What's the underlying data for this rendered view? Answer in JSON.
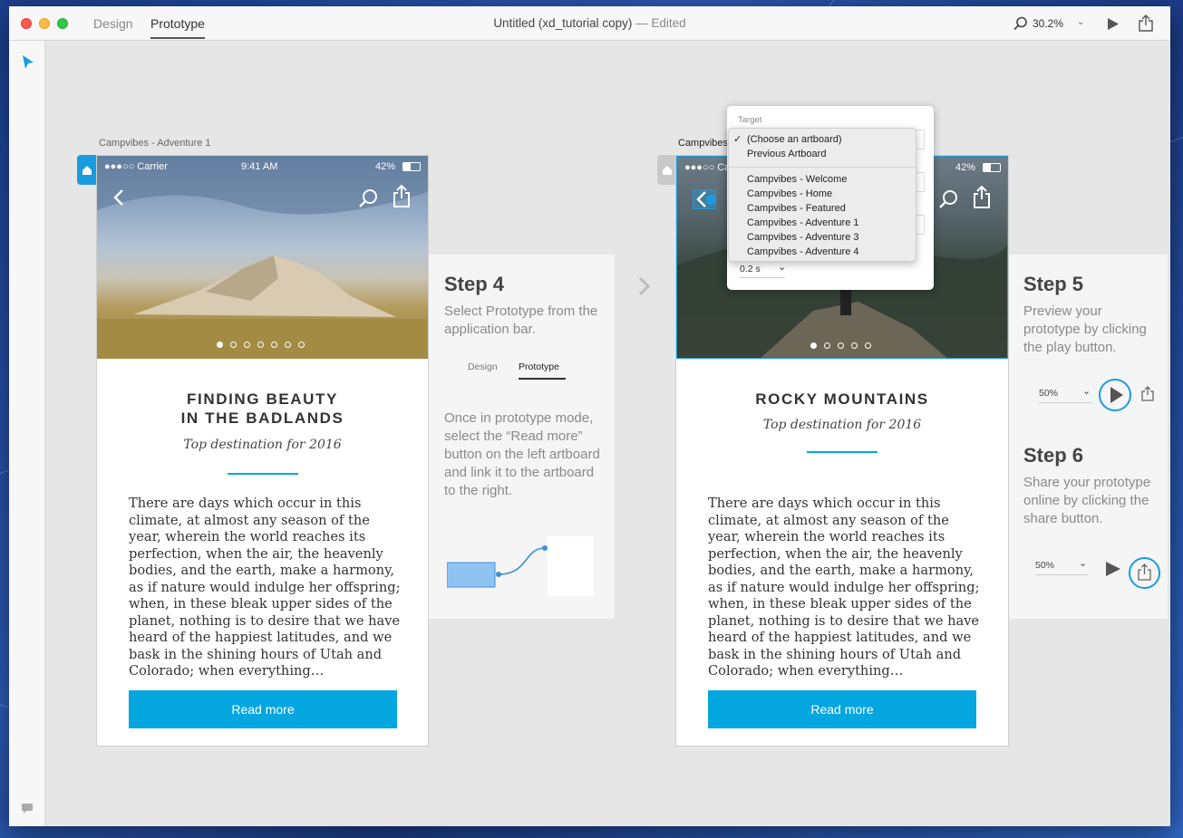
{
  "window": {
    "tabs": [
      "Design",
      "Prototype"
    ],
    "active_tab": "Prototype",
    "title": "Untitled (xd_tutorial copy)",
    "title_status": "— Edited",
    "zoom": "30.2%"
  },
  "artboard_left": {
    "label": "Campvibes - Adventure 1",
    "status": {
      "carrier": "●●●○○ Carrier",
      "time": "9:41 AM",
      "battery": "42%"
    },
    "headline_1": "FINDING BEAUTY",
    "headline_2": "IN THE BADLANDS",
    "subhead": "Top destination for 2016",
    "body": "There are days which occur in this climate, at almost any season of the year, wherein the world reaches its perfection, when the air, the heavenly bodies, and the earth, make a harmony, as if nature would indulge her offspring; when, in these bleak upper sides of the planet, nothing is to desire that we have heard of the happiest latitudes, and we bask in the shining hours of Utah and Colorado; when everything…",
    "button": "Read more"
  },
  "artboard_right": {
    "label": "Campvibes",
    "status": {
      "carrier": "●●●○○ Ca",
      "battery": "42%"
    },
    "headline": "ROCKY MOUNTAINS",
    "subhead": "Top destination for 2016",
    "body": "There are days which occur in this climate, at almost any season of the year, wherein the world reaches its perfection, when the air, the heavenly bodies, and the earth, make a harmony, as if nature would indulge her offspring; when, in these bleak upper sides of the planet, nothing is to desire that we have heard of the happiest latitudes, and we bask in the shining hours of Utah and Colorado; when everything…",
    "button": "Read more"
  },
  "step4": {
    "title": "Step 4",
    "desc": "Select Prototype from the application bar.",
    "tab_design": "Design",
    "tab_prototype": "Prototype",
    "desc2": "Once in prototype mode, select the “Read more” button on the left artboard and link it to the artboard to the right."
  },
  "step5": {
    "title": "Step 5",
    "desc": "Preview your prototype by clicking the play button.",
    "zoom": "50%"
  },
  "step6": {
    "title": "Step 6",
    "desc": "Share your prototype online by clicking the share button.",
    "zoom": "50%"
  },
  "popover": {
    "label": "Target",
    "duration": "0.2 s",
    "options_top": [
      "(Choose an artboard)",
      "Previous Artboard"
    ],
    "options": [
      "Campvibes - Welcome",
      "Campvibes - Home",
      "Campvibes - Featured",
      "Campvibes - Adventure 1",
      "Campvibes - Adventure 3",
      "Campvibes - Adventure 4"
    ]
  },
  "colors": {
    "accent": "#04a6e0",
    "cta": "#04a6e0"
  }
}
